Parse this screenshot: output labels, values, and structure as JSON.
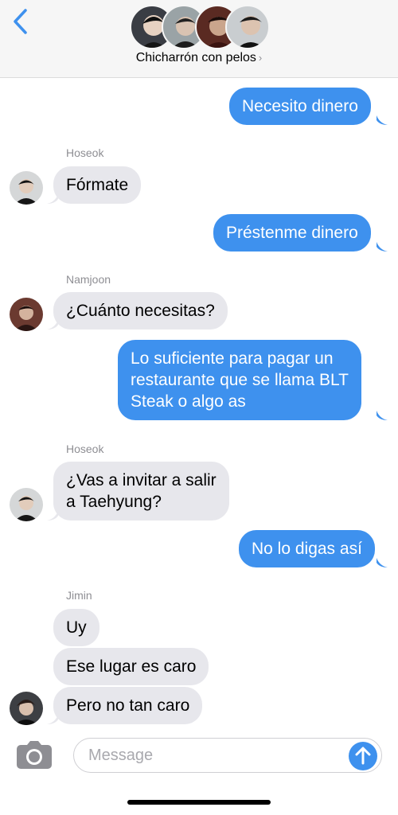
{
  "header": {
    "group_name": "Chicharrón con pelos",
    "chevron": "›",
    "back_icon": "chevron-left-icon"
  },
  "colors": {
    "outgoing_bubble": "#3e91ee",
    "incoming_bubble": "#e7e7ec",
    "accent": "#3e91ee"
  },
  "messages": [
    {
      "direction": "outgoing",
      "text": "Necesito dinero"
    },
    {
      "direction": "incoming",
      "sender": "Hoseok",
      "text": "Fórmate"
    },
    {
      "direction": "outgoing",
      "text": "Préstenme dinero"
    },
    {
      "direction": "incoming",
      "sender": "Namjoon",
      "text": "¿Cuánto necesitas?"
    },
    {
      "direction": "outgoing",
      "lines": [
        "Lo suficiente para pagar un",
        "restaurante que se llama BLT",
        "Steak o algo as"
      ]
    },
    {
      "direction": "incoming",
      "sender": "Hoseok",
      "lines": [
        "¿Vas a invitar a salir",
        "a Taehyung?"
      ]
    },
    {
      "direction": "outgoing",
      "text": "No lo digas así"
    },
    {
      "direction": "incoming",
      "sender": "Jimin",
      "text": "Uy"
    },
    {
      "direction": "incoming",
      "text": "Ese lugar es caro"
    },
    {
      "direction": "incoming",
      "text": "Pero no tan caro"
    }
  ],
  "compose": {
    "placeholder": "Message",
    "camera_icon": "camera-icon",
    "send_icon": "arrow-up-icon"
  }
}
